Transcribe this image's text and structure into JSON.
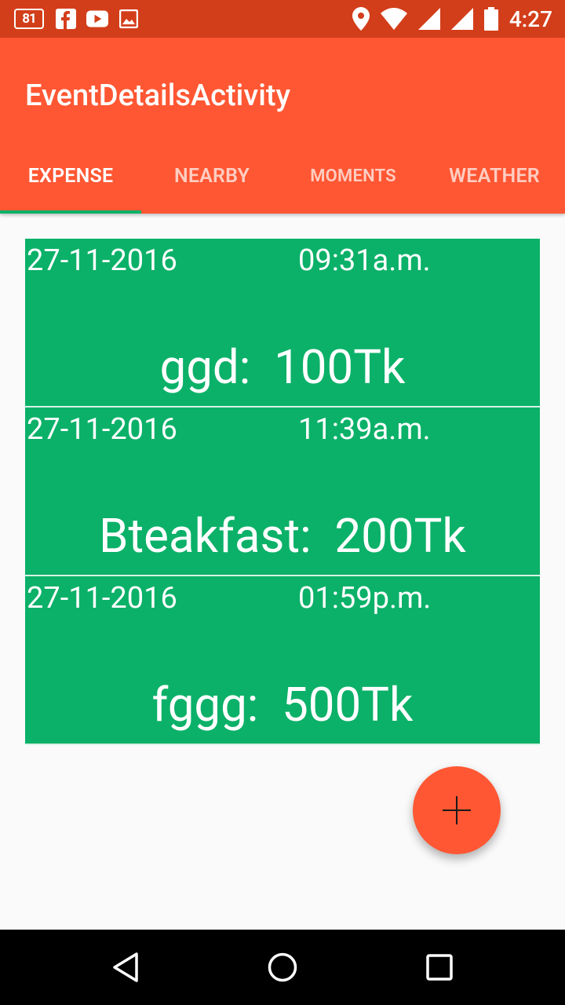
{
  "status_bar": {
    "battery_badge": "81",
    "icons": [
      "battery-badge-icon",
      "facebook-icon",
      "youtube-icon",
      "image-icon",
      "location-icon",
      "wifi-icon",
      "signal-icon",
      "signal-icon-2",
      "battery-icon"
    ],
    "time": "4:27"
  },
  "app_bar": {
    "title": "EventDetailsActivity",
    "tabs": [
      {
        "label": "EXPENSE",
        "active": true
      },
      {
        "label": "NEARBY",
        "active": false
      },
      {
        "label": "MOMENTS",
        "active": false
      },
      {
        "label": "WEATHER",
        "active": false
      }
    ]
  },
  "expenses": [
    {
      "date": "27-11-2016",
      "time": "09:31a.m.",
      "amount": "ggd:  100Tk"
    },
    {
      "date": "27-11-2016",
      "time": "11:39a.m.",
      "amount": "Bteakfast:  200Tk"
    },
    {
      "date": "27-11-2016",
      "time": "01:59p.m.",
      "amount": "fggg:  500Tk"
    }
  ],
  "fab": {
    "icon": "plus-icon"
  },
  "nav_bar": {
    "icons": [
      "back-icon",
      "home-icon",
      "recents-icon"
    ]
  },
  "colors": {
    "status_bar": "#d33e1a",
    "app_bar": "#ff5733",
    "card": "#0bb168",
    "indicator": "#0bb168",
    "fab": "#ff5733"
  }
}
